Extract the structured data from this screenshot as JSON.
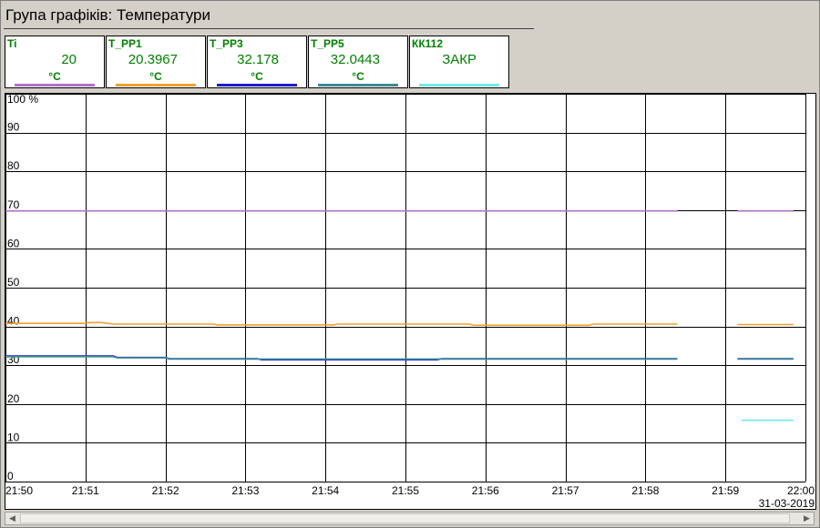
{
  "window": {
    "title": "Група графіків: Температури"
  },
  "cards": [
    {
      "name": "Ti",
      "value": "20",
      "unit": "°C",
      "color": "#b070c8"
    },
    {
      "name": "T_PP1",
      "value": "20.3967",
      "unit": "°C",
      "color": "#f0a030"
    },
    {
      "name": "T_PP3",
      "value": "32.178",
      "unit": "°C",
      "color": "#1a1ad0"
    },
    {
      "name": "T_PP5",
      "value": "32.0443",
      "unit": "°C",
      "color": "#3a8a94"
    },
    {
      "name": "КК112",
      "value": "ЗАКР",
      "unit": "",
      "color": "#70e8f0"
    }
  ],
  "chart_data": {
    "type": "line",
    "ylim": [
      0,
      100
    ],
    "ylabel": "100 %",
    "yticks": [
      "0",
      "10",
      "20",
      "30",
      "40",
      "50",
      "60",
      "70",
      "80",
      "90"
    ],
    "xticks": [
      "21:50",
      "21:51",
      "21:52",
      "21:53",
      "21:54",
      "21:55",
      "21:56",
      "21:57",
      "21:58",
      "21:59",
      "22:00"
    ],
    "xdate": "31-03-2019",
    "grid": true,
    "series": [
      {
        "name": "Ti",
        "color": "#b070c8",
        "segments": [
          [
            [
              0,
              69.8
            ],
            [
              8.4,
              69.8
            ]
          ],
          [
            [
              9.15,
              69.8
            ],
            [
              9.85,
              69.8
            ]
          ]
        ]
      },
      {
        "name": "T_PP1",
        "color": "#f0a030",
        "segments": [
          [
            [
              0,
              40.8
            ],
            [
              1.0,
              40.8
            ],
            [
              1.05,
              41.0
            ],
            [
              1.2,
              41.0
            ],
            [
              1.35,
              40.6
            ],
            [
              2.6,
              40.6
            ],
            [
              2.65,
              40.4
            ],
            [
              4.1,
              40.4
            ],
            [
              4.15,
              40.6
            ],
            [
              5.8,
              40.6
            ],
            [
              5.85,
              40.3
            ],
            [
              7.3,
              40.3
            ],
            [
              7.35,
              40.6
            ],
            [
              8.4,
              40.6
            ]
          ],
          [
            [
              9.15,
              40.5
            ],
            [
              9.85,
              40.5
            ]
          ]
        ]
      },
      {
        "name": "T_PP3",
        "color": "#1a1ad0",
        "segments": [
          [
            [
              0,
              32.4
            ],
            [
              1.35,
              32.4
            ],
            [
              1.4,
              32.0
            ],
            [
              2.0,
              32.0
            ],
            [
              2.05,
              31.7
            ],
            [
              3.15,
              31.7
            ],
            [
              3.2,
              31.4
            ],
            [
              5.4,
              31.4
            ],
            [
              5.45,
              31.7
            ],
            [
              8.4,
              31.7
            ]
          ],
          [
            [
              9.15,
              31.7
            ],
            [
              9.85,
              31.7
            ]
          ]
        ]
      },
      {
        "name": "T_PP5",
        "color": "#3a8a94",
        "segments": [
          [
            [
              0,
              32.2
            ],
            [
              1.35,
              32.2
            ],
            [
              1.4,
              31.9
            ],
            [
              2.0,
              31.9
            ],
            [
              2.05,
              31.6
            ],
            [
              8.4,
              31.6
            ]
          ],
          [
            [
              9.15,
              31.6
            ],
            [
              9.85,
              31.6
            ]
          ]
        ]
      },
      {
        "name": "КК112",
        "color": "#70e8f0",
        "segments": [
          [
            [
              9.2,
              15.8
            ],
            [
              9.85,
              15.8
            ]
          ]
        ]
      }
    ]
  }
}
